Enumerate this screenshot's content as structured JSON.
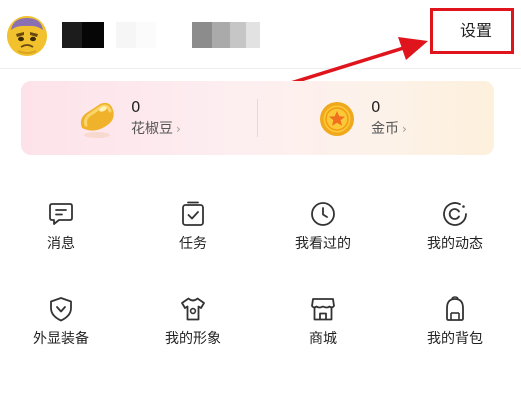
{
  "header": {
    "avatar_icon": "cartoon-avatar",
    "settings_label": "设置"
  },
  "wallet": {
    "pepper": {
      "value": "0",
      "label": "花椒豆",
      "icon": "pepper-bean-icon"
    },
    "coin": {
      "value": "0",
      "label": "金币",
      "icon": "gold-coin-icon"
    },
    "chevron": "›"
  },
  "menu": [
    {
      "label": "消息",
      "icon": "message-icon"
    },
    {
      "label": "任务",
      "icon": "task-icon"
    },
    {
      "label": "我看过的",
      "icon": "history-clock-icon"
    },
    {
      "label": "我的动态",
      "icon": "moments-icon"
    },
    {
      "label": "外显装备",
      "icon": "shield-icon"
    },
    {
      "label": "我的形象",
      "icon": "tshirt-icon"
    },
    {
      "label": "商城",
      "icon": "store-icon"
    },
    {
      "label": "我的背包",
      "icon": "backpack-icon"
    }
  ],
  "colors": {
    "highlight_red": "#e0141c",
    "icon_stroke": "#333333",
    "card_pink": "#fde2ea",
    "card_peach": "#fdf0dc"
  }
}
